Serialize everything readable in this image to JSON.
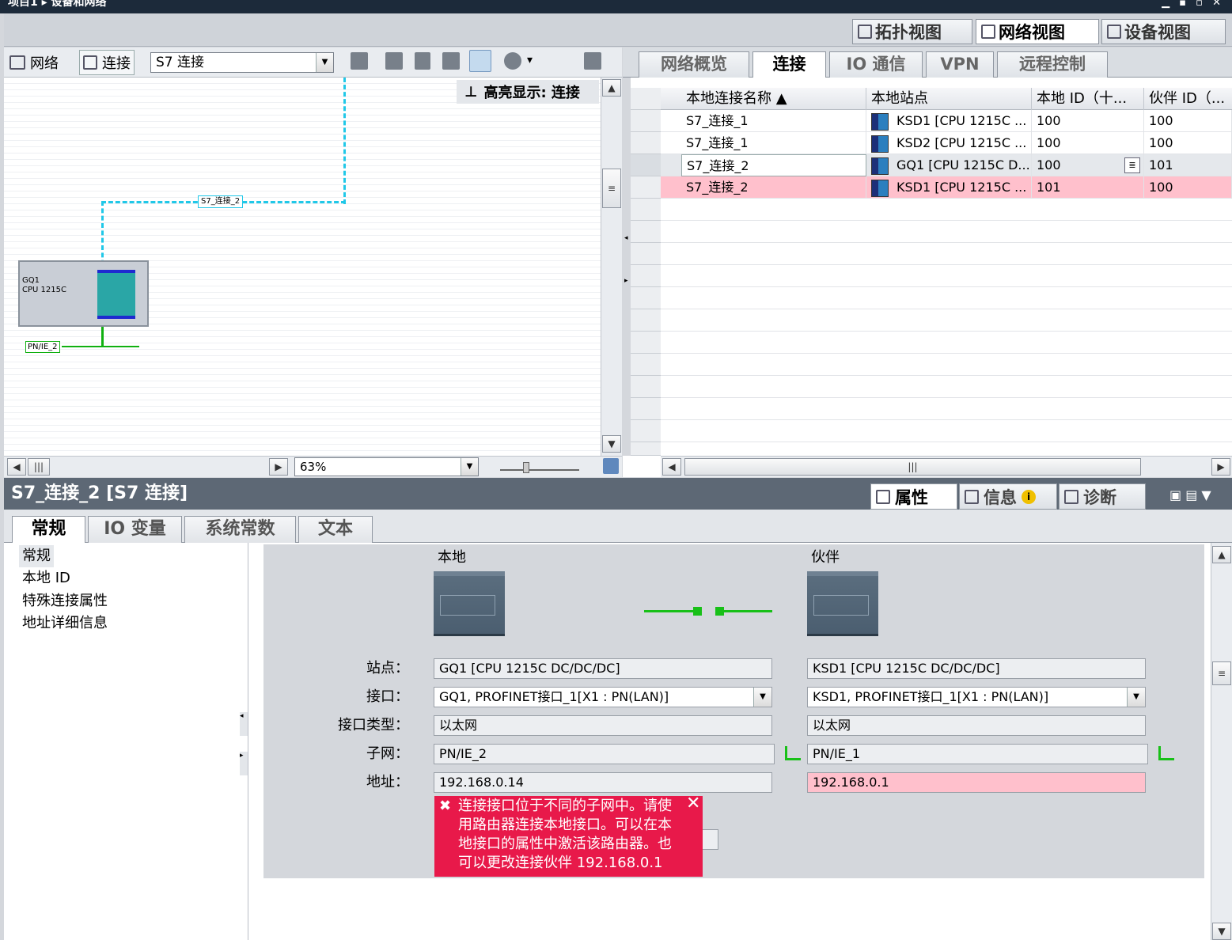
{
  "breadcrumb": "项目1 ▸ 设备和网络",
  "window_buttons": "▁ ▪ ▫ ✕",
  "view_tabs": [
    {
      "label": "拓扑视图",
      "icon": "topology-icon"
    },
    {
      "label": "网络视图",
      "icon": "network-icon"
    },
    {
      "label": "设备视图",
      "icon": "device-icon"
    }
  ],
  "toolbar": {
    "network_label": "网络",
    "connections_label": "连接",
    "connection_type": "S7 连接",
    "highlight": "高亮显示: 连接",
    "zoom": "63%"
  },
  "canvas": {
    "device_name": "GQ1",
    "device_type": "CPU 1215C",
    "subnet_label": "PN/IE_2",
    "connection_label": "S7_连接_2"
  },
  "right_tabs": [
    "网络概览",
    "连接",
    "IO 通信",
    "VPN",
    "远程控制"
  ],
  "table": {
    "headers": [
      "本地连接名称 ▲",
      "本地站点",
      "本地 ID（十...",
      "伙伴 ID（..."
    ],
    "rows": [
      {
        "name": "S7_连接_1",
        "station": "KSD1 [CPU 1215C ...",
        "local_id": "100",
        "partner_id": "100"
      },
      {
        "name": "S7_连接_1",
        "station": "KSD2 [CPU 1215C ...",
        "local_id": "100",
        "partner_id": "100"
      },
      {
        "name": "S7_连接_2",
        "station": "GQ1 [CPU 1215C D...",
        "local_id": "100",
        "partner_id": "101"
      },
      {
        "name": "S7_连接_2",
        "station": "KSD1 [CPU 1215C ...",
        "local_id": "101",
        "partner_id": "100"
      }
    ]
  },
  "inspector": {
    "title": "S7_连接_2 [S7 连接]",
    "tabs": [
      {
        "label": "属性"
      },
      {
        "label": "信息"
      },
      {
        "label": "诊断"
      }
    ],
    "subtabs": [
      "常规",
      "IO 变量",
      "系统常数",
      "文本"
    ],
    "nav": [
      "常规",
      "本地 ID",
      "特殊连接属性",
      "地址详细信息"
    ],
    "local_heading": "本地",
    "partner_heading": "伙伴",
    "labels": {
      "station": "站点：",
      "interface": "接口：",
      "interface_type": "接口类型：",
      "subnet": "子网：",
      "address": "地址："
    },
    "local": {
      "station": "GQ1 [CPU 1215C DC/DC/DC]",
      "interface": "GQ1, PROFINET接口_1[X1 : PN(LAN)]",
      "interface_type": "以太网",
      "subnet": "PN/IE_2",
      "address": "192.168.0.14"
    },
    "partner": {
      "station": "KSD1 [CPU 1215C DC/DC/DC]",
      "interface": "KSD1, PROFINET接口_1[X1 : PN(LAN)]",
      "interface_type": "以太网",
      "subnet": "PN/IE_1",
      "address": "192.168.0.1"
    },
    "error": "连接接口位于不同的子网中。请使用路由器连接本地接口。可以在本地接口的属性中激活该路由器。也可以更改连接伙伴 192.168.0.1"
  },
  "colors": {
    "error": "#e8194a",
    "error_field": "#ffc0cc",
    "connection": "#20c8e8",
    "subnet": "#10b010"
  }
}
